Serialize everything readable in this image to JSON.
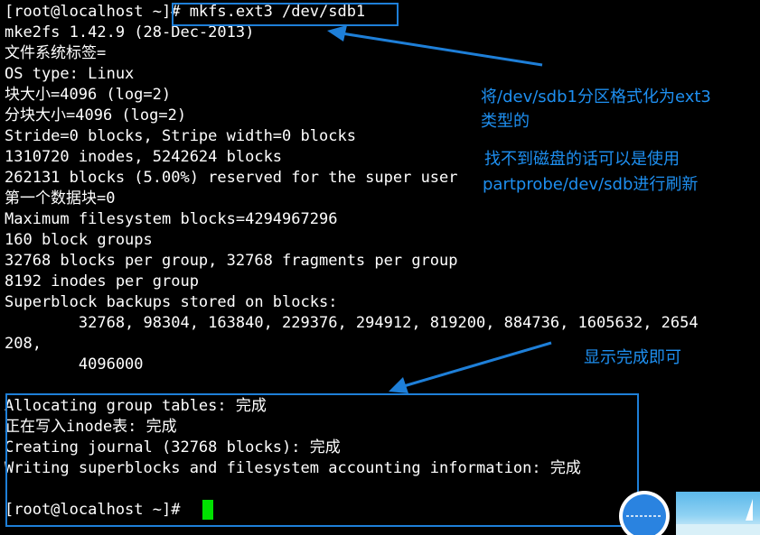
{
  "terminal": {
    "lines": [
      "[root@localhost ~]# mkfs.ext3 /dev/sdb1",
      "mke2fs 1.42.9 (28-Dec-2013)",
      "文件系统标签=",
      "OS type: Linux",
      "块大小=4096 (log=2)",
      "分块大小=4096 (log=2)",
      "Stride=0 blocks, Stripe width=0 blocks",
      "1310720 inodes, 5242624 blocks",
      "262131 blocks (5.00%) reserved for the super user",
      "第一个数据块=0",
      "Maximum filesystem blocks=4294967296",
      "160 block groups",
      "32768 blocks per group, 32768 fragments per group",
      "8192 inodes per group",
      "Superblock backups stored on blocks:",
      "        32768, 98304, 163840, 229376, 294912, 819200, 884736, 1605632, 2654",
      "208,",
      "        4096000",
      "",
      "Allocating group tables: 完成",
      "正在写入inode表: 完成",
      "Creating journal (32768 blocks): 完成",
      "Writing superblocks and filesystem accounting information: 完成",
      "",
      "[root@localhost ~]# "
    ]
  },
  "annotations": {
    "format_note_line1": "将/dev/sdb1分区格式化为ext3",
    "format_note_line2": "类型的",
    "partprobe_note_line1": "找不到磁盘的话可以是使用",
    "partprobe_note_line2": "partprobe/dev/sdb进行刷新",
    "done_note": "显示完成即可"
  },
  "colors": {
    "background": "#000000",
    "text": "#ffffff",
    "annotation": "#1e8ff0",
    "cursor": "#00e000"
  },
  "icons": {
    "circle_widget": "floating-ball-icon",
    "thumbnail": "desktop-thumbnail-icon"
  }
}
